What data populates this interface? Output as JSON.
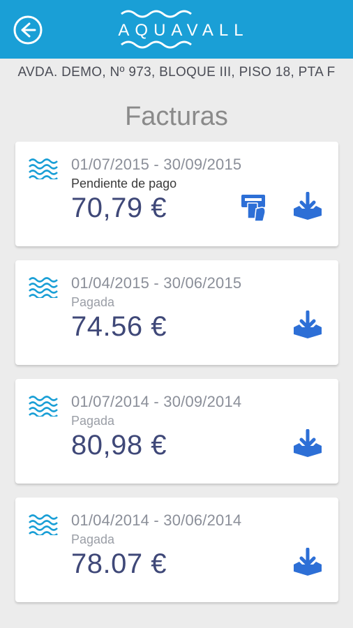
{
  "header": {
    "brand": "AQUAVALL",
    "background": "#1a9fd6"
  },
  "address": "AVDA. DEMO, Nº 973, BLOQUE III, PISO 18, PTA F",
  "title": "Facturas",
  "invoices": [
    {
      "period": "01/07/2015 - 30/09/2015",
      "status": "Pendiente de pago",
      "amount": "70,79 €"
    },
    {
      "period": "01/04/2015 - 30/06/2015",
      "status": "Pagada",
      "amount": "74.56 €"
    },
    {
      "period": "01/07/2014 - 30/09/2014",
      "status": "Pagada",
      "amount": "80,98 €"
    },
    {
      "period": "01/04/2014 - 30/06/2014",
      "status": "Pagada",
      "amount": "78.07 €"
    }
  ],
  "icons": {
    "back": "back-arrow-icon",
    "wave": "water-waves-icon",
    "pay": "atm-card-payment-icon",
    "download": "download-tray-icon"
  },
  "colors": {
    "accent": "#1a9fd6",
    "icon_blue": "#2d6fd6",
    "amount": "#3f4878"
  }
}
